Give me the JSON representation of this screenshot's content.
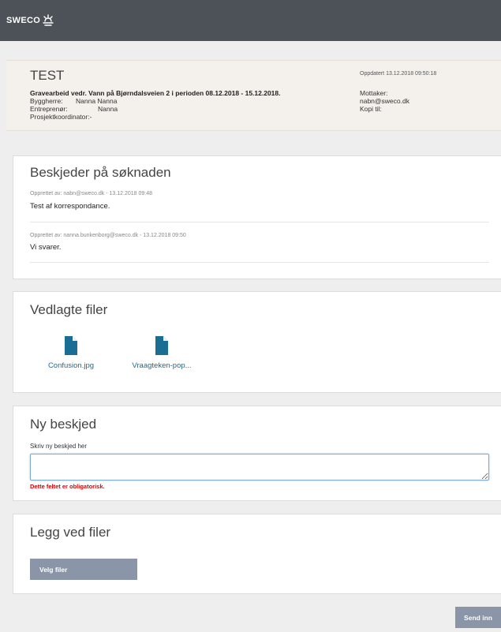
{
  "header": {
    "logo_text": "SWECO"
  },
  "info": {
    "title": "TEST",
    "description": "Gravearbeid vedr. Vann på Bjørndalsveien 2 i perioden 08.12.2018 - 15.12.2018.",
    "byggherre_label": "Byggherre:",
    "byggherre_value": "Nanna   Nanna",
    "entreprenor_label": "Entreprenør:",
    "entreprenor_value": "Nanna",
    "koordinator_label": "Prosjektkoordinator:-",
    "updated": "Oppdatert 13.12.2018 09:50:18",
    "mottaker_label": "Mottaker:",
    "mottaker_value": "nabn@sweco.dk",
    "kopi_label": "Kopi til:"
  },
  "messages": {
    "title": "Beskjeder på søknaden",
    "items": [
      {
        "meta": "Opprettet av: nabn@sweco.dk - 13.12.2018 09:48",
        "text": "Test af korrespondance."
      },
      {
        "meta": "Opprettet av: nanna.bunkenborg@sweco.dk - 13.12.2018 09:50",
        "text": "Vi svarer."
      }
    ]
  },
  "attachments": {
    "title": "Vedlagte filer",
    "files": [
      {
        "name": "Confusion.jpg"
      },
      {
        "name": "Vraagteken-pop..."
      }
    ]
  },
  "new_message": {
    "title": "Ny beskjed",
    "label": "Skriv ny beskjed her",
    "value": "",
    "error": "Dette feltet er obligatorisk."
  },
  "attach": {
    "title": "Legg ved filer",
    "choose_label": "Velg filer"
  },
  "actions": {
    "send_label": "Send inn"
  },
  "colors": {
    "topbar": "#4c5258",
    "link": "#1f6b8f",
    "file_icon": "#1b6e93",
    "error": "#e00000",
    "button": "#8a95a8"
  }
}
